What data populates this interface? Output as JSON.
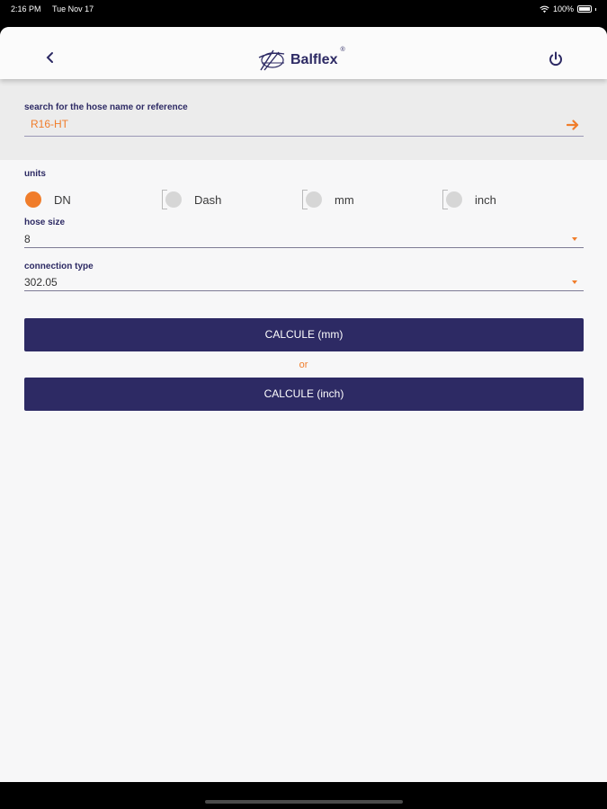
{
  "status": {
    "time": "2:16 PM",
    "date": "Tue Nov 17",
    "battery": "100%"
  },
  "header": {
    "logo": "Balflex",
    "logo_mark": "®"
  },
  "search": {
    "label": "search for the hose name or reference",
    "value": "R16-HT"
  },
  "units": {
    "label": "units",
    "selected": "DN",
    "options": [
      "DN",
      "Dash",
      "mm",
      "inch"
    ]
  },
  "hose_size": {
    "label": "hose size",
    "value": "8"
  },
  "connection_type": {
    "label": "connection type",
    "value": "302.05"
  },
  "actions": {
    "calc_mm": "CALCULE (mm)",
    "or": "or",
    "calc_inch": "CALCULE (inch)"
  },
  "colors": {
    "accent": "#f07d2b",
    "brand": "#2d2a64"
  }
}
